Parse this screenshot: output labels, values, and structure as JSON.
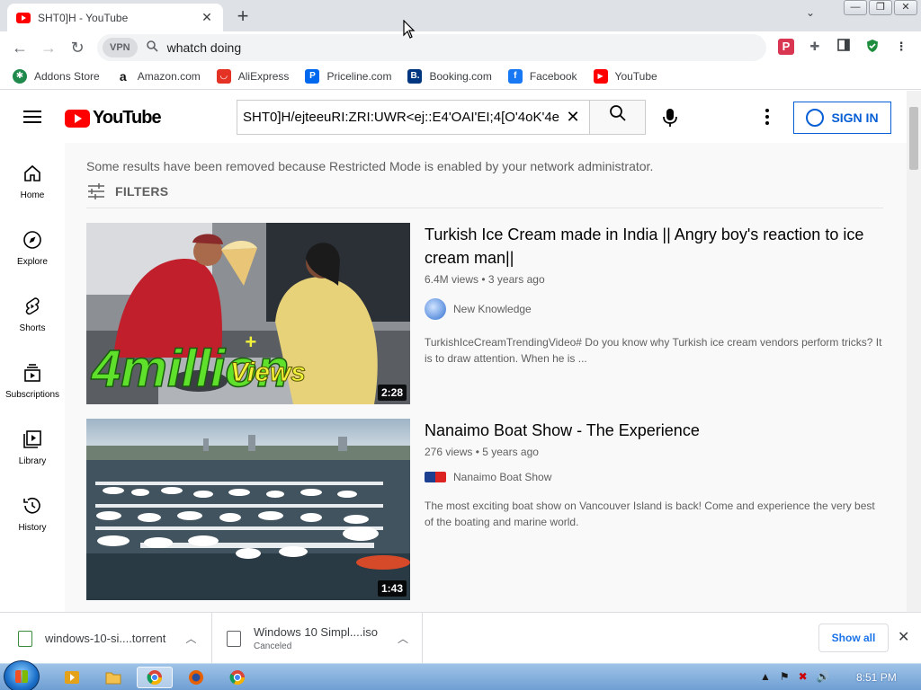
{
  "browser": {
    "tab_title": "SHT0]H - YouTube",
    "tab_close": "✕",
    "new_tab": "+",
    "tab_search": "⌄",
    "omnibox": {
      "vpn_label": "VPN",
      "url": "whatch doing"
    },
    "win_buttons": {
      "minimize": "—",
      "restore": "❐",
      "close": "✕"
    }
  },
  "bookmarks": [
    {
      "label": "Addons Store",
      "color": "#1f8a4c",
      "glyph": "✱"
    },
    {
      "label": "Amazon.com",
      "color": "#ffffff",
      "glyph": "a"
    },
    {
      "label": "AliExpress",
      "color": "#e43225",
      "glyph": "◡"
    },
    {
      "label": "Priceline.com",
      "color": "#0068ef",
      "glyph": "P"
    },
    {
      "label": "Booking.com",
      "color": "#003580",
      "glyph": "B."
    },
    {
      "label": "Facebook",
      "color": "#1877f2",
      "glyph": "f"
    },
    {
      "label": "YouTube",
      "color": "#ff0000",
      "glyph": "▶"
    }
  ],
  "youtube": {
    "logo_text": "YouTube",
    "search_query": "SHT0]H/ejteeuRI:ZRI:UWR<ej::E4'OAI'EI;4[O'4oK'4e",
    "search_clear": "✕",
    "sign_in": "SIGN IN",
    "sidebar": [
      {
        "label": "Home",
        "icon": "home-icon"
      },
      {
        "label": "Explore",
        "icon": "explore-icon"
      },
      {
        "label": "Shorts",
        "icon": "shorts-icon"
      },
      {
        "label": "Subscriptions",
        "icon": "subscriptions-icon"
      },
      {
        "label": "Library",
        "icon": "library-icon"
      },
      {
        "label": "History",
        "icon": "history-icon"
      }
    ],
    "notice": "Some results have been removed because Restricted Mode is enabled by your network administrator.",
    "filters_label": "FILTERS",
    "videos": [
      {
        "title": "Turkish Ice Cream made in India || Angry boy's reaction to ice cream man||",
        "views": "6.4M views",
        "age": "3 years ago",
        "channel": "New Knowledge",
        "description": "TurkishIceCreamTrendingVideo# Do you know why Turkish ice cream vendors perform tricks? It is to draw attention. When he is ...",
        "duration": "2:28",
        "thumb_overlay_1": "4million",
        "thumb_overlay_2": "Views",
        "thumb_overlay_plus": "+"
      },
      {
        "title": "Nanaimo Boat Show - The Experience",
        "views": "276 views",
        "age": "5 years ago",
        "channel": "Nanaimo Boat Show",
        "description": "The most exciting boat show on Vancouver Island is back! Come and experience the very best of the boating and marine world.",
        "duration": "1:43"
      }
    ]
  },
  "downloads": [
    {
      "name": "windows-10-si....torrent",
      "status": ""
    },
    {
      "name": "Windows 10 Simpl....iso",
      "status": "Canceled"
    }
  ],
  "shelf": {
    "show_all": "Show all",
    "close": "✕"
  },
  "taskbar": {
    "clock": "8:51 PM"
  }
}
